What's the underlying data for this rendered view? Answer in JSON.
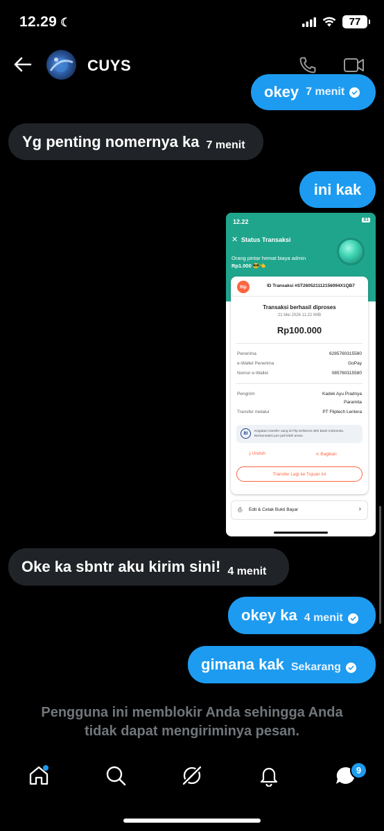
{
  "status_bar": {
    "time": "12.29",
    "battery": "77"
  },
  "header": {
    "contact_name": "CUYS"
  },
  "messages": [
    {
      "dir": "out",
      "text": "okey",
      "time": "7 menit"
    },
    {
      "dir": "in",
      "text": "Yg penting nomernya ka",
      "time": "7 menit"
    },
    {
      "dir": "out",
      "text": "ini kak",
      "time": ""
    },
    {
      "dir": "in",
      "text": "Oke ka sbntr aku kirim sini!",
      "time": "4 menit"
    },
    {
      "dir": "out",
      "text": "okey ka",
      "time": "4 menit"
    },
    {
      "dir": "out",
      "text": "gimana kak",
      "time": "Sekarang"
    }
  ],
  "attachment": {
    "status_time": "12.22",
    "battery": "81",
    "title": "Status Transaksi",
    "promo_line1": "Orang pintar hemat biaya admin",
    "promo_line2": "Rp1.000",
    "brand": "flip",
    "transaction_id": "ID Transaksi #ST260521112156094X1QB7",
    "status": "Transaksi berhasil diproses",
    "date": "21 Mei 2026 11.22 WIB",
    "amount": "Rp100.000",
    "rows": [
      {
        "label": "Penerima",
        "value": "6285760315580"
      },
      {
        "label": "e-Wallet Penerima",
        "value": "GoPay"
      },
      {
        "label": "Nomor e-Wallet",
        "value": "085760315580"
      }
    ],
    "sender_label": "Pengirim",
    "sender_name_1": "Kadek Ayu Pradnya",
    "sender_name_2": "Paramita",
    "transfer_label": "Transfer melalui",
    "transfer_value": "PT Fliptech Lentera",
    "notice_line1": "Kegiatan transfer uang di Flip terlisensi oleh Bank Indonesia.",
    "notice_line2": "Bertransaksi pun jadi lebih aman.",
    "download": "Unduh",
    "share": "Bagikan",
    "transfer_again": "Transfer Lagi ke Tujuan Ini",
    "edit_print": "Edit & Cetak Bukti Bayar"
  },
  "blocked_notice": {
    "line1": "Pengguna ini memblokir Anda sehingga Anda",
    "line2": "tidak dapat mengiriminya pesan."
  },
  "bottom_nav": {
    "messages_badge": "9"
  },
  "colors": {
    "accent": "#1d9bf0",
    "incoming": "#202327",
    "flip_green": "#1fa58c",
    "flip_orange": "#fd6542"
  }
}
